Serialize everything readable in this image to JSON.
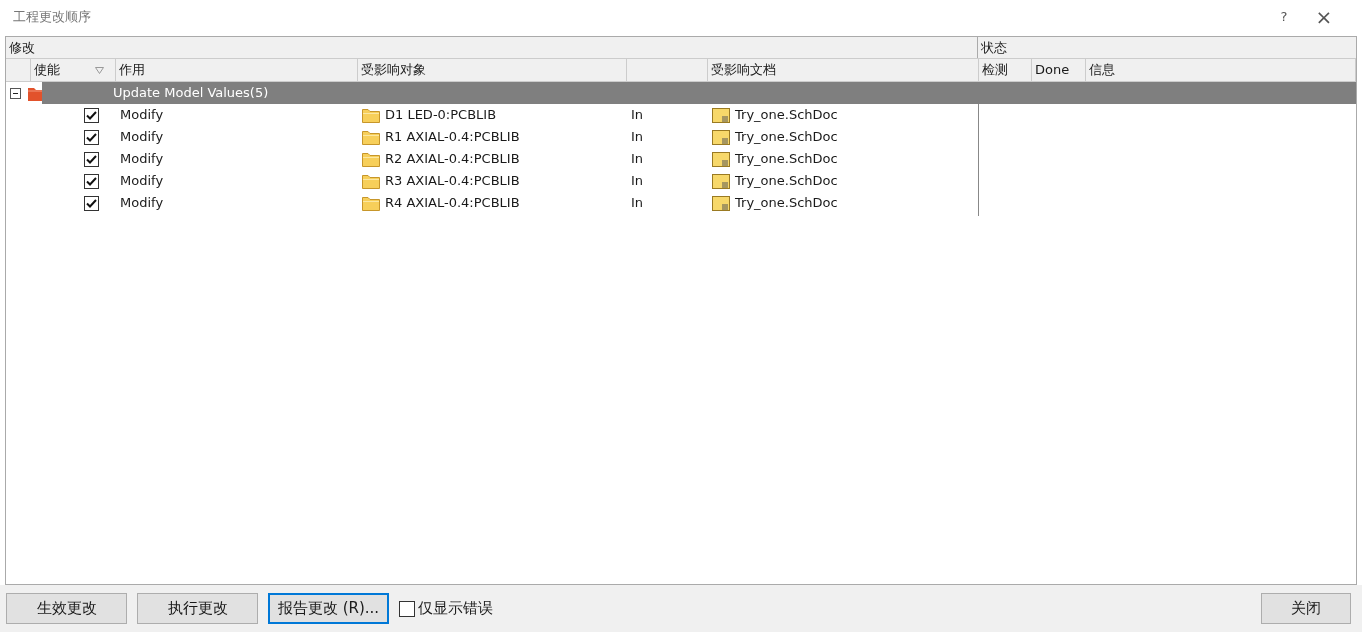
{
  "window": {
    "title": "工程更改顺序",
    "buttons": [
      "?",
      "×"
    ]
  },
  "header_groups": [
    "修改",
    "状态"
  ],
  "columns": [
    "使能",
    "作用",
    "受影响对象",
    "受影响文档",
    "检测",
    "Done",
    "信息"
  ],
  "group": {
    "label": "Update Model Values(5)",
    "expanded": true
  },
  "rows": [
    {
      "enabled": true,
      "action": "Modify",
      "object": "D1 LED-0:PCBLIB",
      "direction": "In",
      "document": "Try_one.SchDoc"
    },
    {
      "enabled": true,
      "action": "Modify",
      "object": "R1 AXIAL-0.4:PCBLIB",
      "direction": "In",
      "document": "Try_one.SchDoc"
    },
    {
      "enabled": true,
      "action": "Modify",
      "object": "R2 AXIAL-0.4:PCBLIB",
      "direction": "In",
      "document": "Try_one.SchDoc"
    },
    {
      "enabled": true,
      "action": "Modify",
      "object": "R3 AXIAL-0.4:PCBLIB",
      "direction": "In",
      "document": "Try_one.SchDoc"
    },
    {
      "enabled": true,
      "action": "Modify",
      "object": "R4 AXIAL-0.4:PCBLIB",
      "direction": "In",
      "document": "Try_one.SchDoc"
    }
  ],
  "buttons": [
    {
      "label": "生效更改",
      "focused": false
    },
    {
      "label": "执行更改",
      "focused": false
    },
    {
      "label": "报告更改 (R)...",
      "focused": true
    }
  ],
  "only_errors": {
    "label": "仅显示错误",
    "checked": false
  },
  "close_button": "关闭"
}
